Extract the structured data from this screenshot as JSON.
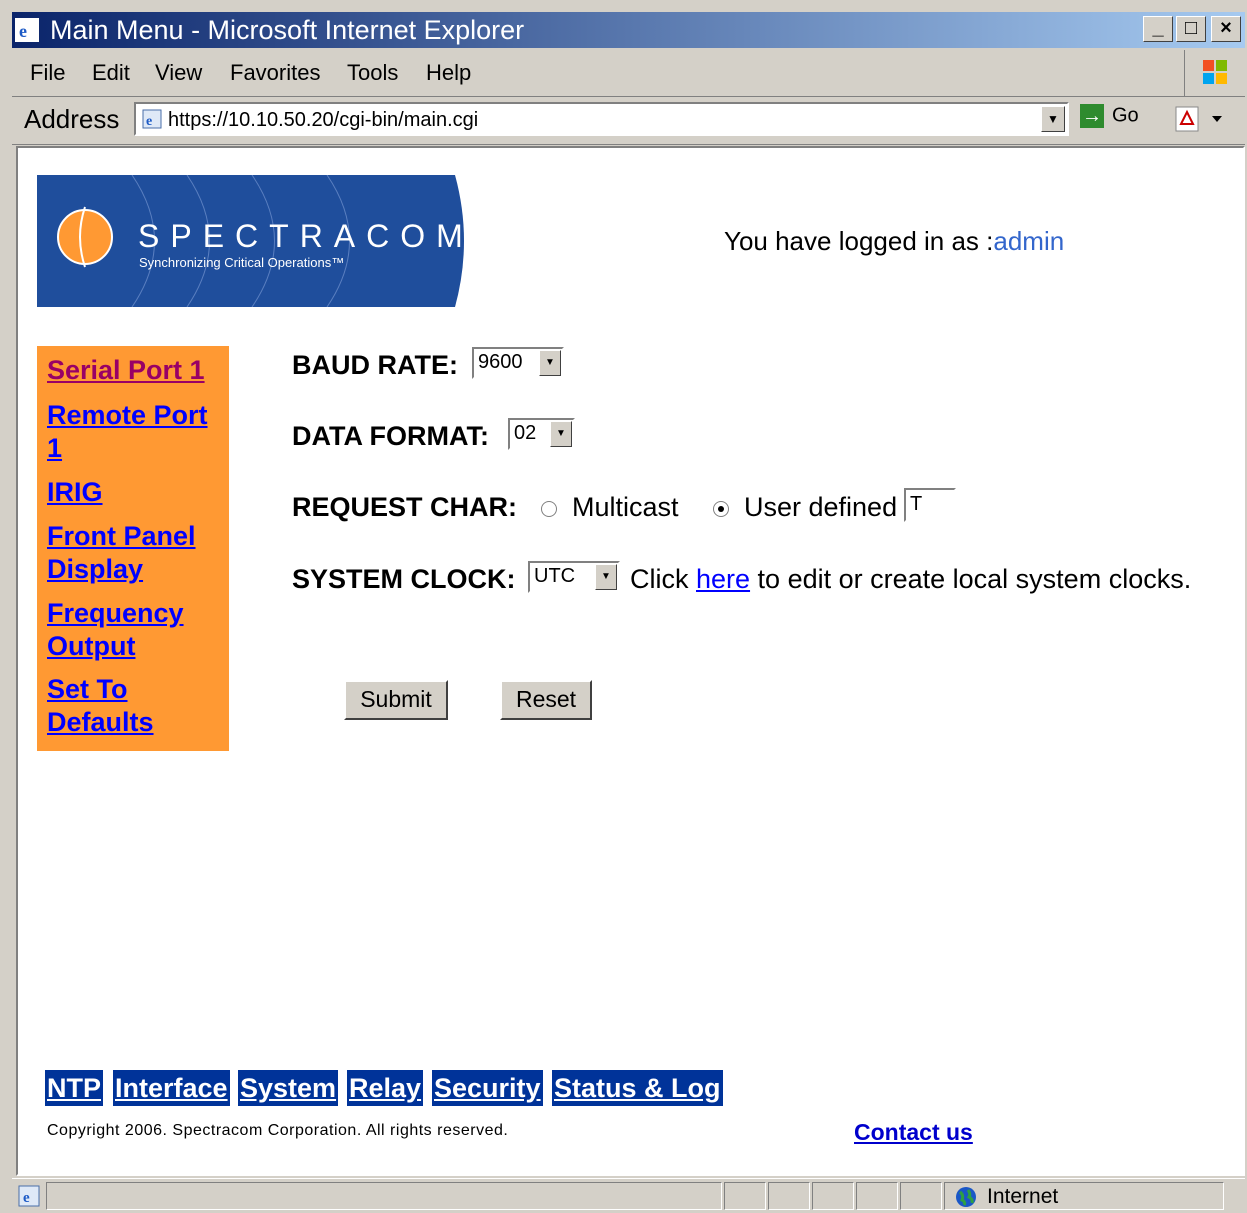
{
  "window": {
    "title": "Main Menu - Microsoft Internet Explorer",
    "minimize_label": "_",
    "maximize_label": "□",
    "close_label": "×"
  },
  "menubar": {
    "items": [
      "File",
      "Edit",
      "View",
      "Favorites",
      "Tools",
      "Help"
    ]
  },
  "addressbar": {
    "label": "Address",
    "url": "https://10.10.50.20/cgi-bin/main.cgi",
    "go_label": "Go"
  },
  "header": {
    "brand": "SPECTRACOM",
    "tagline": "Synchronizing Critical Operations™",
    "login_prefix": "You have logged in as :",
    "login_user": "admin"
  },
  "sidebar": {
    "items": [
      {
        "label": "Serial Port 1"
      },
      {
        "label": "Remote Port 1"
      },
      {
        "label": "IRIG"
      },
      {
        "label": "Front Panel Display"
      },
      {
        "label": "Frequency Output"
      },
      {
        "label": "Set To Defaults"
      }
    ]
  },
  "form": {
    "baud_label": "BAUD RATE:",
    "baud_value": "9600",
    "format_label": "DATA FORMAT:",
    "format_value": "02",
    "request_label": "REQUEST CHAR:",
    "multicast_label": "Multicast",
    "user_defined_label": "User defined",
    "user_defined_value": "T",
    "clock_label": "SYSTEM CLOCK:",
    "clock_value": "UTC",
    "clock_note_before": "Click ",
    "clock_note_link": "here",
    "clock_note_after": " to edit or create local system clocks.",
    "submit_label": "Submit",
    "reset_label": "Reset"
  },
  "footer": {
    "nav": [
      "NTP",
      "Interface",
      "System",
      "Relay",
      "Security",
      "Status & Log"
    ],
    "copyright": "Copyright 2006. Spectracom Corporation. All rights reserved.",
    "contact_label": "Contact us"
  },
  "statusbar": {
    "zone": "Internet"
  }
}
